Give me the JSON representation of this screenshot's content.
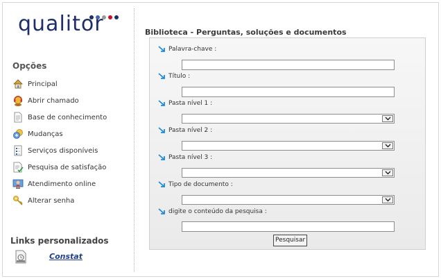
{
  "logo": {
    "text": "qualitor",
    "dot_colors": [
      "#1d2e6b",
      "#4a63a8",
      "#9a9a9a",
      "#c8102e",
      "#1d2e6b"
    ]
  },
  "sidebar": {
    "options_title": "Opções",
    "items": [
      {
        "label": "Principal",
        "icon": "home-icon"
      },
      {
        "label": "Abrir chamado",
        "icon": "support-agent-icon"
      },
      {
        "label": "Base de conhecimento",
        "icon": "document-icon"
      },
      {
        "label": "Mudanças",
        "icon": "change-icon"
      },
      {
        "label": "Serviços disponíveis",
        "icon": "services-list-icon"
      },
      {
        "label": "Pesquisa de satisfação",
        "icon": "survey-icon"
      },
      {
        "label": "Atendimento online",
        "icon": "online-support-icon"
      },
      {
        "label": "Alterar senha",
        "icon": "key-icon"
      }
    ],
    "links_title": "Links personalizados",
    "custom_links": [
      {
        "label": "Constat",
        "icon": "custom-link-icon"
      }
    ]
  },
  "main": {
    "title": "Biblioteca - Perguntas, soluções e documentos",
    "fields": [
      {
        "label": "Palavra-chave :",
        "type": "text",
        "value": ""
      },
      {
        "label": "Título :",
        "type": "text",
        "value": ""
      },
      {
        "label": "Pasta nível 1 :",
        "type": "select",
        "value": ""
      },
      {
        "label": "Pasta nível 2 :",
        "type": "select",
        "value": ""
      },
      {
        "label": "Pasta nível 3 :",
        "type": "select",
        "value": ""
      },
      {
        "label": "Tipo de documento :",
        "type": "select",
        "value": ""
      },
      {
        "label": "digite o conteúdo da pesquisa :",
        "type": "text",
        "value": ""
      }
    ],
    "search_button": "Pesquisar"
  },
  "colors": {
    "brand_navy": "#1d2e6b",
    "accent_red": "#c8102e",
    "arrow_blue": "#1f8bd6",
    "link_blue": "#1d3f8a"
  }
}
